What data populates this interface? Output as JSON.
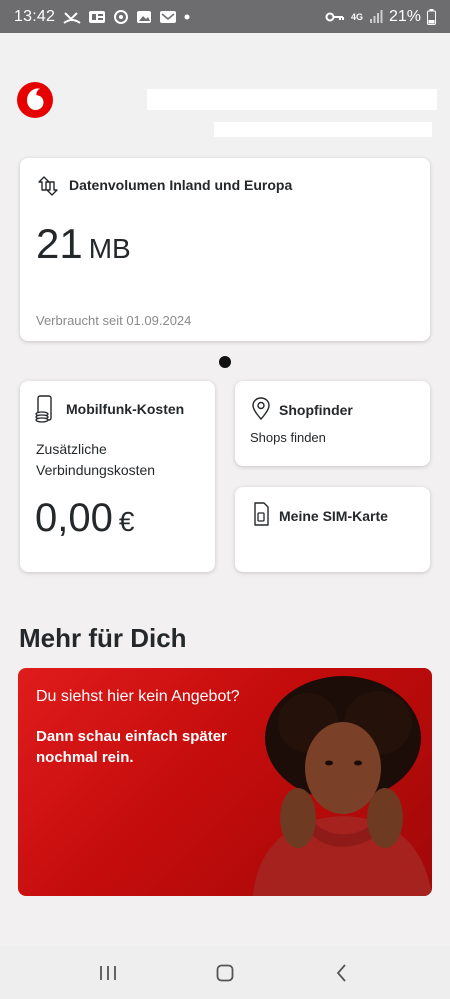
{
  "status_bar": {
    "time": "13:42",
    "battery": "21%",
    "network": "4G"
  },
  "data_card": {
    "title": "Datenvolumen Inland und Europa",
    "amount": "21",
    "unit": "MB",
    "since": "Verbraucht seit 01.09.2024",
    "icon": "data-transfer-icon"
  },
  "costs_card": {
    "title": "Mobilfunk-Kosten",
    "description": "Zusätzliche Verbindungskosten",
    "value": "0,00",
    "currency": "€",
    "icon": "phone-coins-icon"
  },
  "shop_card": {
    "title": "Shopfinder",
    "subtitle": "Shops finden",
    "icon": "location-pin-icon"
  },
  "sim_card": {
    "title": "Meine SIM-Karte",
    "icon": "sim-card-icon"
  },
  "section": {
    "title": "Mehr für Dich"
  },
  "promo": {
    "headline": "Du siehst hier kein Angebot?",
    "text": "Dann schau einfach später nochmal rein."
  },
  "colors": {
    "brand_red": "#e60000",
    "background": "#f2f0f0"
  }
}
